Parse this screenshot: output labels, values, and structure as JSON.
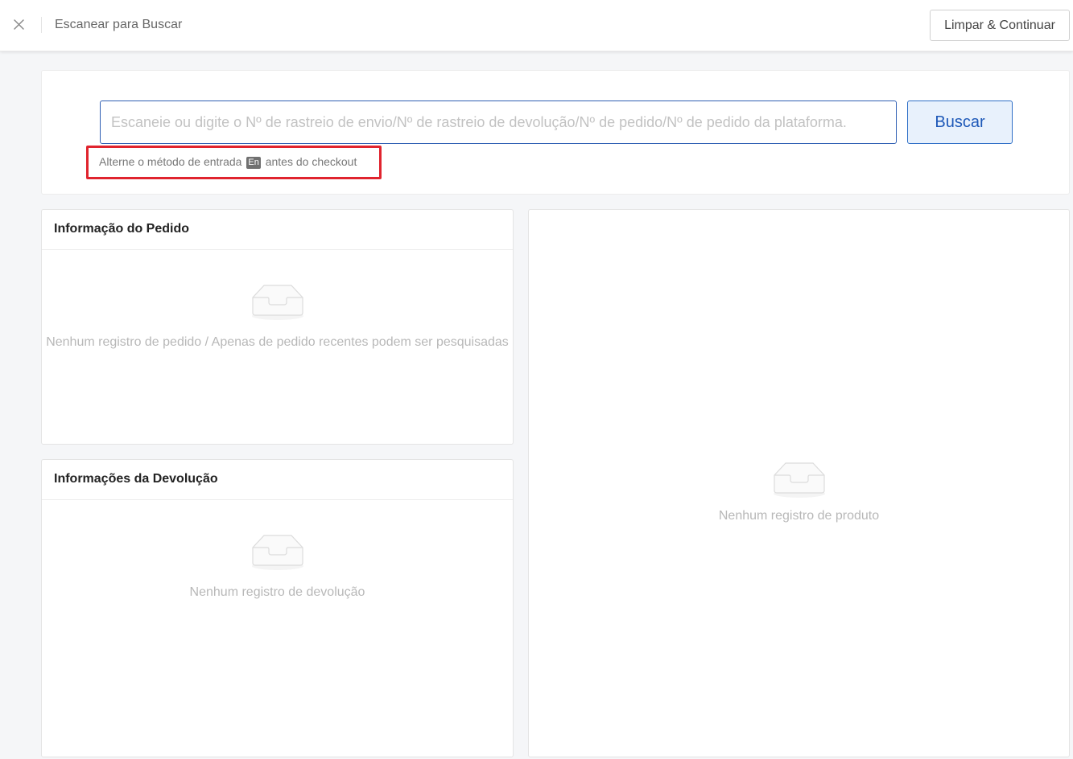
{
  "header": {
    "title": "Escanear para Buscar",
    "continue_label": "Limpar & Continuar"
  },
  "search": {
    "placeholder": "Escaneie ou digite o Nº de rastreio de envio/Nº de rastreio de devolução/Nº de pedido/Nº de pedido da plataforma.",
    "button_label": "Buscar",
    "hint_before": "Alterne o método de entrada",
    "hint_badge": "En",
    "hint_after": "antes do checkout"
  },
  "order_panel": {
    "title": "Informação do Pedido",
    "empty_text": "Nenhum registro de pedido / Apenas de pedido recentes podem ser pesquisadas"
  },
  "return_panel": {
    "title": "Informações da Devolução",
    "empty_text": "Nenhum registro de devolução"
  },
  "product_panel": {
    "empty_text": "Nenhum registro de produto"
  },
  "icons": {
    "close": "close-icon",
    "empty": "empty-inbox-icon"
  },
  "colors": {
    "accent": "#1d58b8",
    "highlight": "#e0242e"
  }
}
